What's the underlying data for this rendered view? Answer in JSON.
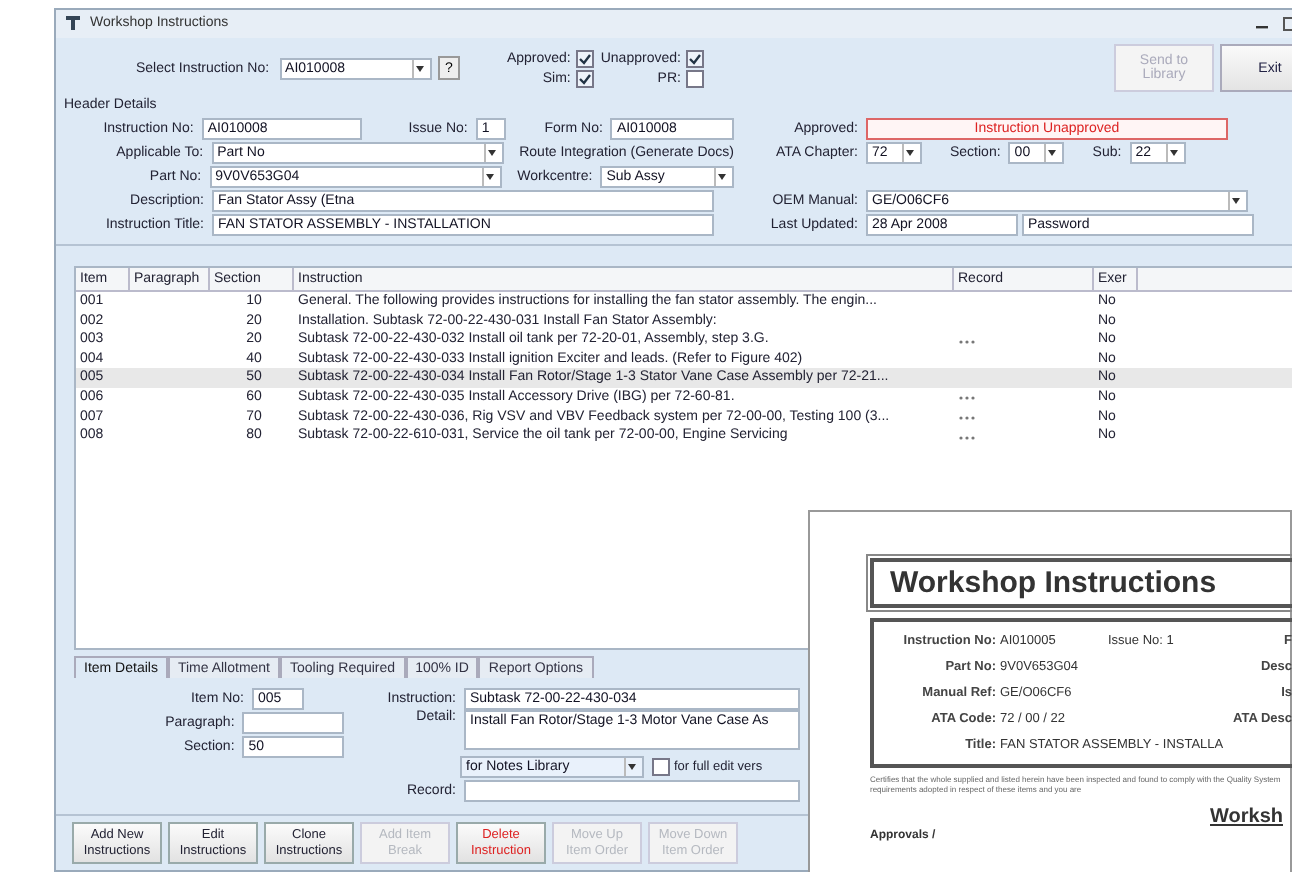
{
  "window": {
    "title": "Workshop Instructions"
  },
  "top": {
    "select_label": "Select Instruction No:",
    "select_value": "AI010008",
    "help_button": "?",
    "checkboxes": [
      {
        "label": "Approved:",
        "checked": true
      },
      {
        "label": "Unapproved:",
        "checked": true
      },
      {
        "label": "Sim:",
        "checked": true
      },
      {
        "label": "PR:",
        "checked": false
      }
    ],
    "buttons": [
      {
        "label": "Send to Library",
        "disabled": true
      },
      {
        "label": "Exit",
        "disabled": false
      }
    ]
  },
  "header": {
    "title": "Header Details",
    "instruction_no": {
      "label": "Instruction No:",
      "value": "AI010008"
    },
    "issue_no": {
      "label": "Issue No:",
      "value": "1"
    },
    "form_no": {
      "label": "Form No:",
      "value": "AI010008"
    },
    "approved": {
      "label": "Approved:",
      "value": "Instruction Unapproved"
    },
    "applicable_to": {
      "label": "Applicable To:",
      "value": "Part No"
    },
    "route_integration": "Route Integration (Generate Docs)",
    "ata": [
      {
        "label": "ATA Chapter:",
        "value": "72"
      },
      {
        "label": "Section:",
        "value": "00"
      },
      {
        "label": "Sub:",
        "value": "22"
      }
    ],
    "part_no": {
      "label": "Part No:",
      "value": "9V0V653G04"
    },
    "workcentre": {
      "label": "Workcentre:",
      "value": "Sub Assy"
    },
    "description": {
      "label": "Description:",
      "value": "Fan Stator Assy (Etna"
    },
    "oem_manual": {
      "label": "OEM Manual:",
      "value": "GE/O06CF6"
    },
    "instruction_title": {
      "label": "Instruction Title:",
      "value": "FAN STATOR ASSEMBLY - INSTALLATION"
    },
    "last_updated": {
      "label": "Last Updated:",
      "value": "28 Apr 2008",
      "user": "Password"
    }
  },
  "table": {
    "columns": [
      "Item",
      "Paragraph",
      "Section",
      "Instruction",
      "Record",
      "Exer"
    ],
    "rows": [
      {
        "item": "001",
        "section": "10",
        "instruction": "General. The following provides instructions for installing the fan stator assembly. The engin...",
        "record_button": false,
        "exer": "No",
        "selected": false
      },
      {
        "item": "002",
        "section": "20",
        "instruction": "Installation. Subtask 72-00-22-430-031 Install Fan Stator Assembly:",
        "record_button": false,
        "exer": "No",
        "selected": false
      },
      {
        "item": "003",
        "section": "20",
        "instruction": "Subtask 72-00-22-430-032 Install oil tank per 72-20-01, Assembly, step 3.G.",
        "record_button": true,
        "exer": "No",
        "selected": false
      },
      {
        "item": "004",
        "section": "40",
        "instruction": "Subtask 72-00-22-430-033 Install ignition Exciter and leads. (Refer to Figure 402)",
        "record_button": false,
        "exer": "No",
        "selected": false
      },
      {
        "item": "005",
        "section": "50",
        "instruction": "Subtask 72-00-22-430-034 Install Fan Rotor/Stage 1-3 Stator Vane Case Assembly per 72-21...",
        "record_button": false,
        "exer": "No",
        "selected": true
      },
      {
        "item": "006",
        "section": "60",
        "instruction": "Subtask 72-00-22-430-035 Install Accessory Drive (IBG) per 72-60-81.",
        "record_button": true,
        "exer": "No",
        "selected": false
      },
      {
        "item": "007",
        "section": "70",
        "instruction": "Subtask 72-00-22-430-036, Rig VSV and VBV Feedback system per 72-00-00, Testing 100 (3...",
        "record_button": true,
        "exer": "No",
        "selected": false
      },
      {
        "item": "008",
        "section": "80",
        "instruction": "Subtask 72-00-22-610-031, Service the oil tank per 72-00-00, Engine Servicing",
        "record_button": true,
        "exer": "No",
        "selected": false
      }
    ]
  },
  "tabs": [
    {
      "label": "Item Details",
      "selected": true
    },
    {
      "label": "Time Allotment",
      "selected": false
    },
    {
      "label": "Tooling Required",
      "selected": false
    },
    {
      "label": "100% ID",
      "selected": false
    },
    {
      "label": "Report Options",
      "selected": false
    }
  ],
  "item_details": {
    "item_no": {
      "label": "Item No:",
      "value": "005"
    },
    "paragraph": {
      "label": "Paragraph:"
    },
    "section": {
      "label": "Section:",
      "value": "50"
    },
    "instruction": {
      "label": "Instruction:",
      "value": "Subtask 72-00-22-430-034"
    },
    "detail": {
      "label": "Detail:",
      "value": "Install Fan Rotor/Stage 1-3 Motor Vane Case As"
    },
    "notes": {
      "value": "for Notes Library"
    },
    "full_edit": {
      "label": "for full edit vers",
      "checked": false
    },
    "record": {
      "label": "Record:"
    }
  },
  "buttons": [
    {
      "label": "Add New Instructions",
      "disabled": false,
      "kind": "normal"
    },
    {
      "label": "Edit Instructions",
      "disabled": false,
      "kind": "normal"
    },
    {
      "label": "Clone Instructions",
      "disabled": false,
      "kind": "normal"
    },
    {
      "label": "Add Item Break",
      "disabled": true,
      "kind": "normal"
    },
    {
      "label": "Delete Instruction",
      "disabled": false,
      "kind": "danger"
    },
    {
      "label": "Move Up Item Order",
      "disabled": true,
      "kind": "normal"
    },
    {
      "label": "Move Down Item Order",
      "disabled": true,
      "kind": "normal"
    }
  ],
  "document": {
    "heading": "Workshop Instructions",
    "rows": [
      {
        "label": "Instruction No:",
        "value": "AI010005",
        "mid": "Issue No: 1",
        "edge": "F"
      },
      {
        "label": "Part No:",
        "value": "9V0V653G04",
        "edge": "Desc"
      },
      {
        "label": "Manual Ref:",
        "value": "GE/O06CF6",
        "edge": "Is"
      },
      {
        "label": "ATA Code:",
        "value": "72 / 00 / 22",
        "edge": "ATA Desc"
      }
    ],
    "title": {
      "label": "Title:",
      "value": "FAN STATOR ASSEMBLY - INSTALLA"
    },
    "note": "Certifies that the whole supplied and listed herein have been inspected and found to comply with the Quality System requirements adopted in respect of these items and you are",
    "subheading": "Worksh",
    "approvals": "Approvals /"
  }
}
